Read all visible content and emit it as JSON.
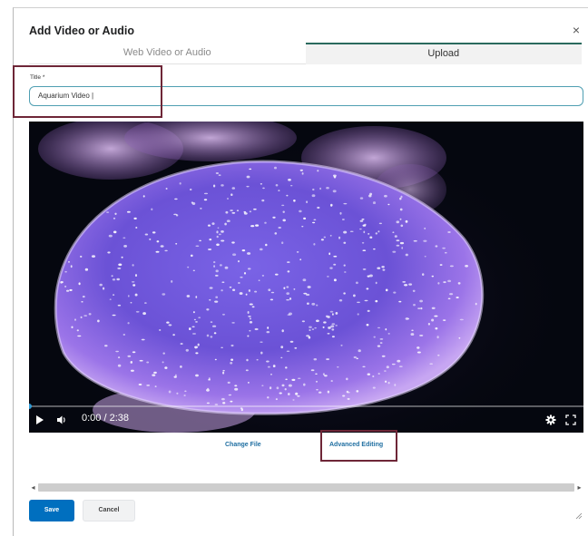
{
  "dialog": {
    "title": "Add Video or Audio",
    "close_glyph": "×"
  },
  "tabs": [
    {
      "label": "Web Video or Audio",
      "active": false
    },
    {
      "label": "Upload",
      "active": true
    }
  ],
  "form": {
    "title_label": "Title *",
    "title_value": "Aquarium Video |"
  },
  "player": {
    "time": "0:00 / 2:38",
    "progress": 0,
    "icons": [
      "play-icon",
      "volume-icon",
      "settings-icon",
      "fullscreen-icon"
    ]
  },
  "links": {
    "change_file": "Change File",
    "advanced_editing": "Advanced Editing"
  },
  "buttons": {
    "save": "Save",
    "cancel": "Cancel"
  },
  "colors": {
    "primary": "#006fbf",
    "tab_accent": "#2a6a5e",
    "highlight": "#6e2637",
    "link": "#1e6ea1",
    "input_border": "#4f9fb2"
  }
}
